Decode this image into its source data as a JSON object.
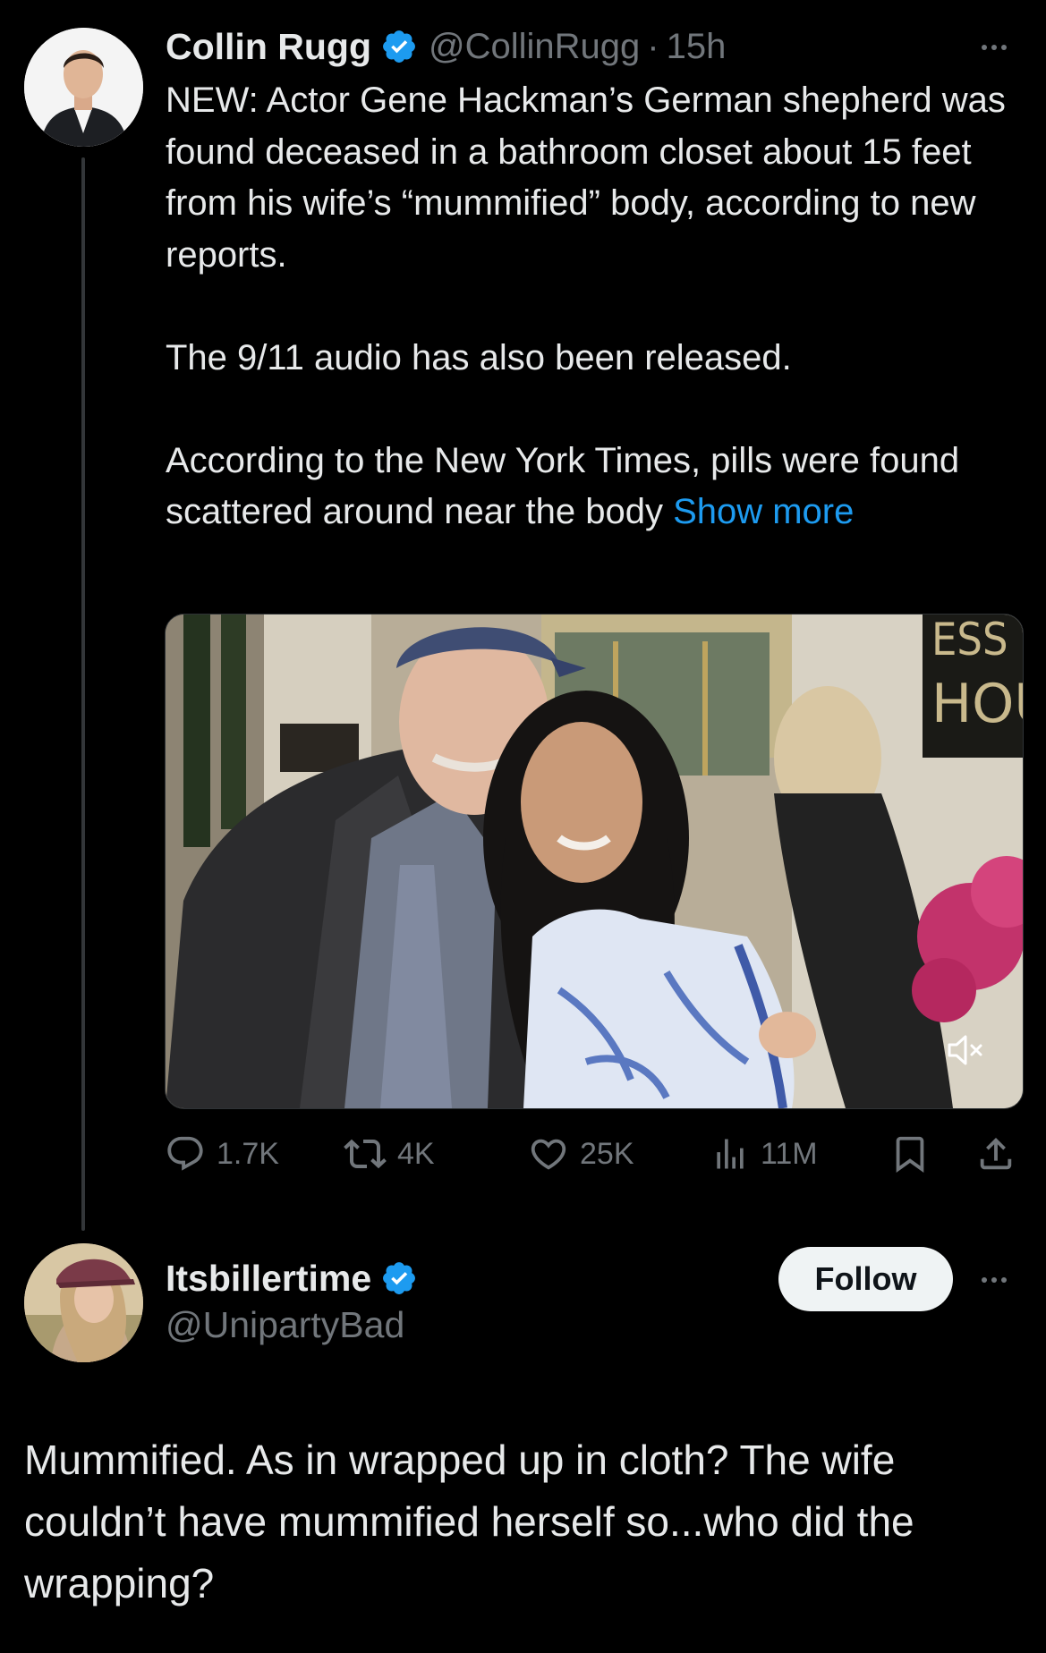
{
  "tweet": {
    "author": {
      "display_name": "Collin Rugg",
      "verified": true,
      "handle": "@CollinRugg",
      "time": "15h"
    },
    "paragraphs": [
      "NEW: Actor Gene Hackman’s German shepherd was found deceased in a bathroom closet about 15 feet from his wife’s “mummified” body, according to new reports.",
      "The 9/11 audio has also been released.",
      "According to the New York Times, pills were found scattered around near the body"
    ],
    "show_more_label": "Show more",
    "media": {
      "sign_text_top": "ESS",
      "sign_text_bottom": "HOU",
      "muted": true
    },
    "stats": {
      "replies": "1.7K",
      "reposts": "4K",
      "likes": "25K",
      "views": "11M"
    }
  },
  "reply": {
    "author": {
      "display_name": "Itsbillertime",
      "verified": true,
      "handle": "@UnipartyBad"
    },
    "follow_label": "Follow",
    "text": "Mummified. As in wrapped up in cloth? The wife couldn’t have mummified herself so...who did the wrapping?"
  },
  "colors": {
    "background": "#000000",
    "text": "#e7e9ea",
    "muted": "#71767b",
    "accent": "#1d9bf0"
  }
}
